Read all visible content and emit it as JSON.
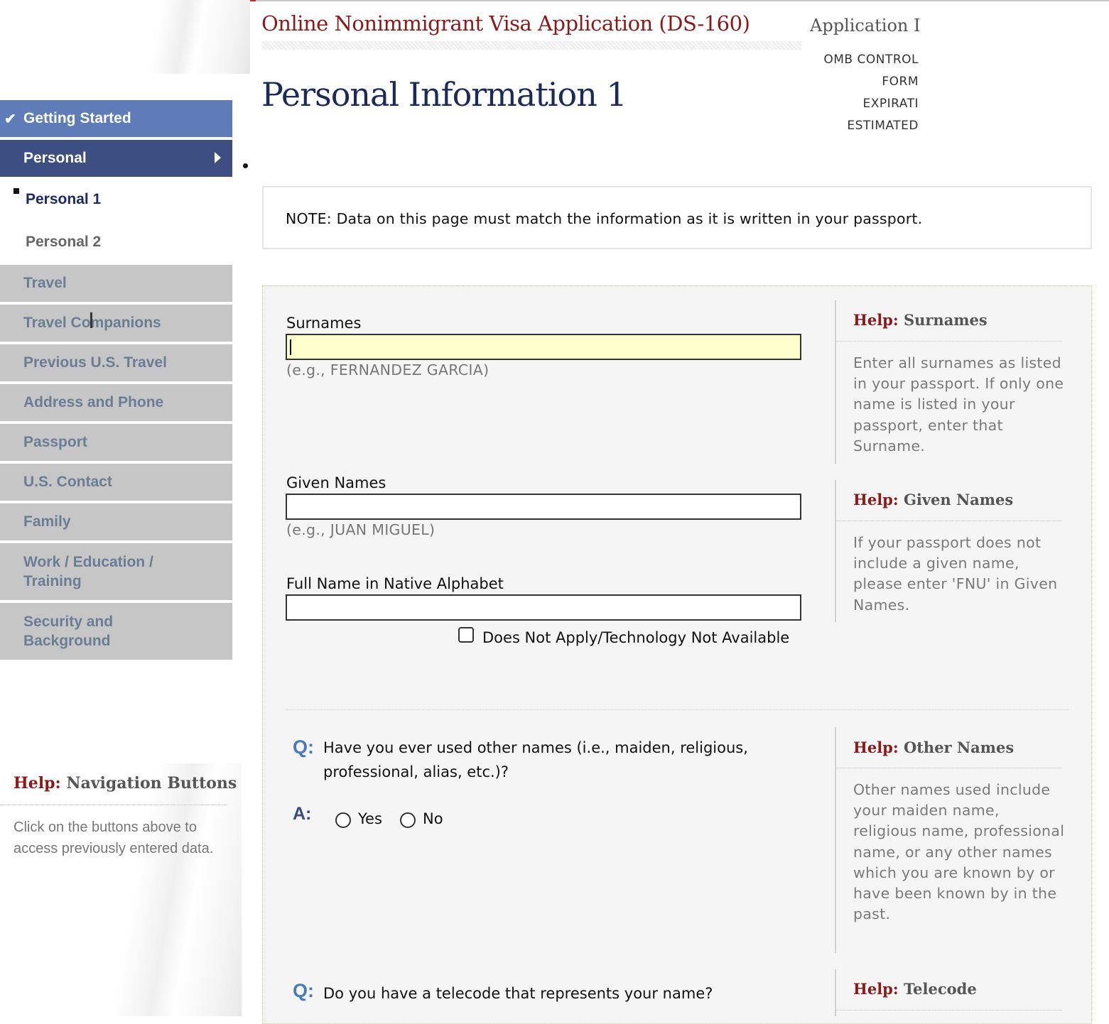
{
  "header": {
    "app_title": "Online Nonimmigrant Visa Application (DS-160)",
    "application_id_label": "Application ID",
    "meta": [
      "OMB CONTROL",
      "FORM",
      "EXPIRATI",
      "ESTIMATED"
    ],
    "page_title": "Personal Information 1"
  },
  "sidebar": {
    "items": [
      {
        "label": "Getting Started",
        "state": "done"
      },
      {
        "label": "Personal",
        "state": "current"
      },
      {
        "label": "Personal 1",
        "state": "sub-active"
      },
      {
        "label": "Personal 2",
        "state": "sub"
      },
      {
        "label": "Travel",
        "state": "pending"
      },
      {
        "label": "Travel Companions",
        "state": "pending"
      },
      {
        "label": "Previous U.S. Travel",
        "state": "pending"
      },
      {
        "label": "Address and Phone",
        "state": "pending"
      },
      {
        "label": "Passport",
        "state": "pending"
      },
      {
        "label": "U.S. Contact",
        "state": "pending"
      },
      {
        "label": "Family",
        "state": "pending"
      },
      {
        "label": "Work / Education / Training",
        "state": "pending"
      },
      {
        "label": "Security and Background",
        "state": "pending"
      }
    ]
  },
  "nav_help": {
    "prefix": "Help:",
    "title": "Navigation Buttons",
    "text": "Click on the buttons above to access previously entered data."
  },
  "note": "NOTE: Data on this page must match the information as it is written in your passport.",
  "form": {
    "surnames": {
      "label": "Surnames",
      "value": "",
      "example": "(e.g., FERNANDEZ GARCIA)"
    },
    "given_names": {
      "label": "Given Names",
      "value": "",
      "example": "(e.g., JUAN MIGUEL)"
    },
    "native_name": {
      "label": "Full Name in Native Alphabet",
      "value": ""
    },
    "does_not_apply": "Does Not Apply/Technology Not Available",
    "q_marker": "Q:",
    "a_marker": "A:",
    "other_names_question": "Have you ever used other names (i.e., maiden, religious, professional, alias, etc.)?",
    "yes_label": "Yes",
    "no_label": "No",
    "telecode_question": "Do you have a telecode that represents your name?"
  },
  "help": {
    "prefix": "Help:",
    "surnames": {
      "title": "Surnames",
      "text": "Enter all surnames as listed in your passport. If only one name is listed in your passport, enter that Surname."
    },
    "given_names": {
      "title": "Given Names",
      "text": "If your passport does not include a given name, please enter 'FNU' in Given Names."
    },
    "other_names": {
      "title": "Other Names",
      "text": "Other names used include your maiden name, religious name, professional name, or any other names which you are known by or have been known by in the past."
    },
    "telecode": {
      "title": "Telecode"
    }
  },
  "colors": {
    "title_red": "#8b1a1a",
    "page_title_navy": "#1c2a5a",
    "nav_done": "#5e7cb8",
    "nav_current": "#3d4f82",
    "nav_pending": "#c6c6c6",
    "focused_input": "#ffffcc"
  }
}
